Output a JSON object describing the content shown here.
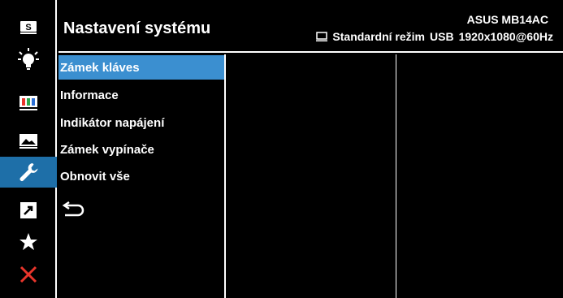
{
  "header": {
    "title": "Nastavení systému",
    "model": "ASUS MB14AC",
    "mode": "Standardní režim",
    "input": "USB",
    "resolution": "1920x1080@60Hz"
  },
  "iconbar": {
    "items": [
      {
        "name": "splendid-icon",
        "label": "S"
      },
      {
        "name": "blue-light-filter-icon"
      },
      {
        "name": "color-icon"
      },
      {
        "name": "image-icon"
      },
      {
        "name": "system-setup-icon",
        "active": true
      },
      {
        "name": "shortcut-icon"
      },
      {
        "name": "my-favorite-icon"
      },
      {
        "name": "exit-icon"
      }
    ]
  },
  "menu": {
    "items": [
      {
        "label": "Zámek kláves",
        "selected": true
      },
      {
        "label": "Informace"
      },
      {
        "label": "Indikátor napájení"
      },
      {
        "label": "Zámek vypínače"
      },
      {
        "label": "Obnovit vše"
      }
    ],
    "back_icon": "back-arrow-icon"
  },
  "colors": {
    "background": "#000000",
    "active_icon_bg": "#1e6fa8",
    "selected_item_bg": "#3b8fd0",
    "exit_red": "#e8352b",
    "text": "#ffffff"
  }
}
